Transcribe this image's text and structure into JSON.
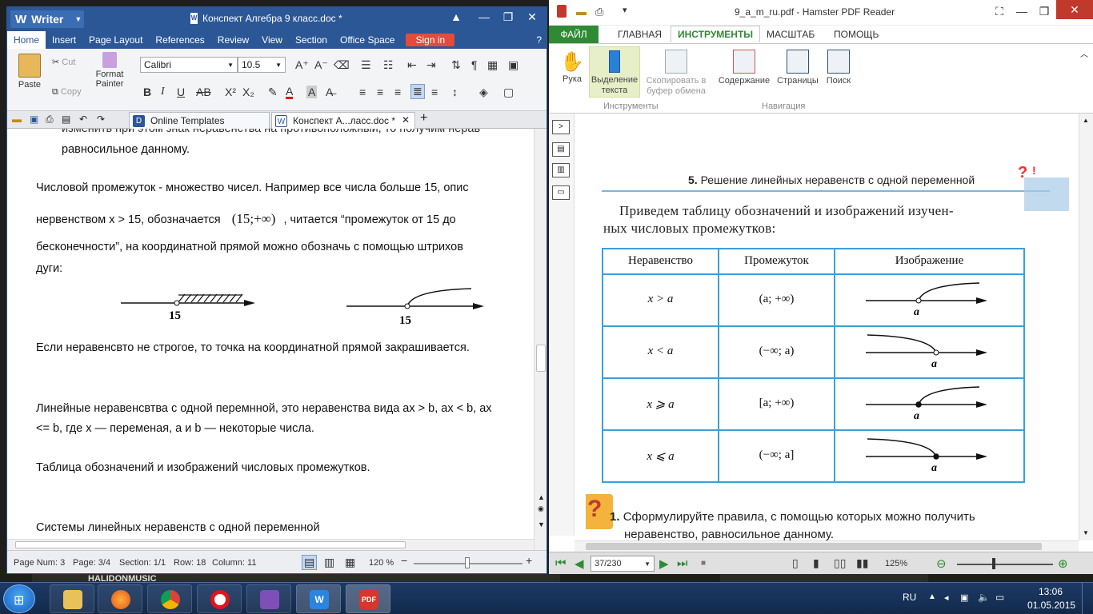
{
  "writer": {
    "app_name": "Writer",
    "doc_title": "Конспект Алгебра 9 класс.doc *",
    "menu": [
      "Home",
      "Insert",
      "Page Layout",
      "References",
      "Review",
      "View",
      "Section",
      "Office Space"
    ],
    "sign_in": "Sign in",
    "ribbon": {
      "paste": "Paste",
      "cut": "Cut",
      "copy": "Copy",
      "format_painter_1": "Format",
      "format_painter_2": "Painter",
      "font_name": "Calibri",
      "font_size": "10.5"
    },
    "tabs": [
      "Online Templates",
      "Конспект А...ласс.doc *"
    ],
    "body": {
      "line_top_cut": "изменить при этом знак неравенства на противоположный, то получим нерав",
      "line_equiv": "равносильное данному.",
      "p1_l1": "Числовой промежуток - множество чисел. Например все числа больше 15, опис",
      "p1_l2": "нервенством  x  >  15,  обозначается",
      "p1_interval": "(15;+∞)",
      "p1_l2b": ",  читается  “промежуток  от  15  до",
      "p1_l3": "бесконечности”, на координатной прямой можно обозначь с помощью штрихов",
      "p1_l4": "дуги:",
      "fig1_label": "15",
      "fig2_label": "15",
      "p2": "Если неравенсвто не строгое, то точка на координатной прямой закрашивается.",
      "p3_l1": "Линейные неравенсвтва с одной перемнной, это неравенства вида ax > b, ax < b, ax",
      "p3_l2": "<= b, где x — переменая, a и b — некоторые числа.",
      "p4": "Таблица обозначений и изображений числовых промежутков.",
      "p5": "Системы линейных неравенств с одной переменной"
    },
    "status": {
      "page_num": "Page Num: 3",
      "page": "Page: 3/4",
      "section": "Section: 1/1",
      "row": "Row: 18",
      "column": "Column: 11",
      "zoom": "120 %"
    }
  },
  "hamster": {
    "title": "9_a_m_ru.pdf - Hamster PDF Reader",
    "tabs": [
      "ФАЙЛ",
      "ГЛАВНАЯ",
      "ИНСТРУМЕНТЫ",
      "МАСШТАБ",
      "ПОМОЩЬ"
    ],
    "ribbon": {
      "hand": "Рука",
      "select_1": "Выделение",
      "select_2": "текста",
      "copy_1": "Скопировать в",
      "copy_2": "буфер обмена",
      "contents": "Содержание",
      "pages": "Страницы",
      "search": "Поиск",
      "group_tools": "Инструменты",
      "group_nav": "Навигация"
    },
    "page": {
      "section_num": "5.",
      "section_title": "Решение линейных неравенств с одной переменной",
      "heading_l1": "Приведем таблицу обозначений и изображений изучен-",
      "heading_l2": "ных числовых промежутков:",
      "table_headers": [
        "Неравенство",
        "Промежуток",
        "Изображение"
      ],
      "table_rows": [
        {
          "ineq": "x > a",
          "interval": "(a; +∞)",
          "label": "a"
        },
        {
          "ineq": "x < a",
          "interval": "(−∞; a)",
          "label": "a"
        },
        {
          "ineq": "x ⩾ a",
          "interval": "[a; +∞)",
          "label": "a"
        },
        {
          "ineq": "x ⩽ a",
          "interval": "(−∞; a]",
          "label": "a"
        }
      ],
      "question_num": "1.",
      "question_l1": "Сформулируйте правила, с помощью которых можно получить",
      "question_l2": "неравенство, равносильное данному."
    },
    "nav": {
      "page_input": "37/230",
      "zoom": "125%"
    }
  },
  "behind": {
    "text": "HALIDONMUSIC"
  },
  "taskbar": {
    "lang": "RU",
    "time": "13:06",
    "date": "01.05.2015"
  }
}
